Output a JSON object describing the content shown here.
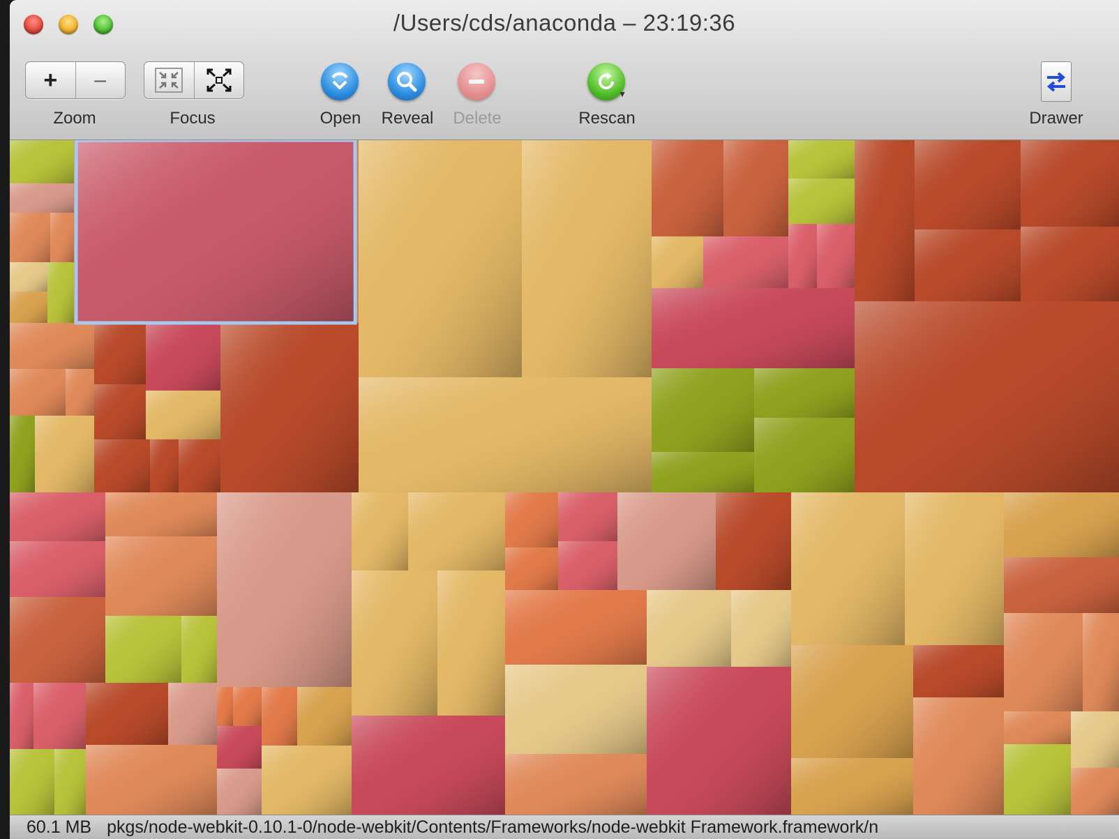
{
  "window": {
    "title": "/Users/cds/anaconda – 23:19:36"
  },
  "toolbar": {
    "zoom": {
      "label": "Zoom",
      "in_glyph": "+",
      "out_glyph": "–"
    },
    "focus": {
      "label": "Focus"
    },
    "open": {
      "label": "Open",
      "icon": "open-icon"
    },
    "reveal": {
      "label": "Reveal",
      "icon": "magnifier-icon"
    },
    "delete": {
      "label": "Delete",
      "icon": "minus-circle-icon",
      "enabled": false
    },
    "rescan": {
      "label": "Rescan",
      "icon": "refresh-icon"
    },
    "drawer": {
      "label": "Drawer",
      "icon": "swap-arrows-icon"
    }
  },
  "treemap": {
    "palette": [
      "#e3b866",
      "#d8a24f",
      "#e08a5a",
      "#c9623e",
      "#d9606a",
      "#c84a5a",
      "#b8c23a",
      "#8fa21f",
      "#d89a8a",
      "#e6c98a",
      "#b84a2a",
      "#e27a4a"
    ],
    "selected_color": "#c75a6a",
    "selection_outline": "#a8c8f0"
  },
  "status": {
    "size": "60.1 MB",
    "path": "pkgs/node-webkit-0.10.1-0/node-webkit/Contents/Frameworks/node-webkit Framework.framework/n"
  }
}
